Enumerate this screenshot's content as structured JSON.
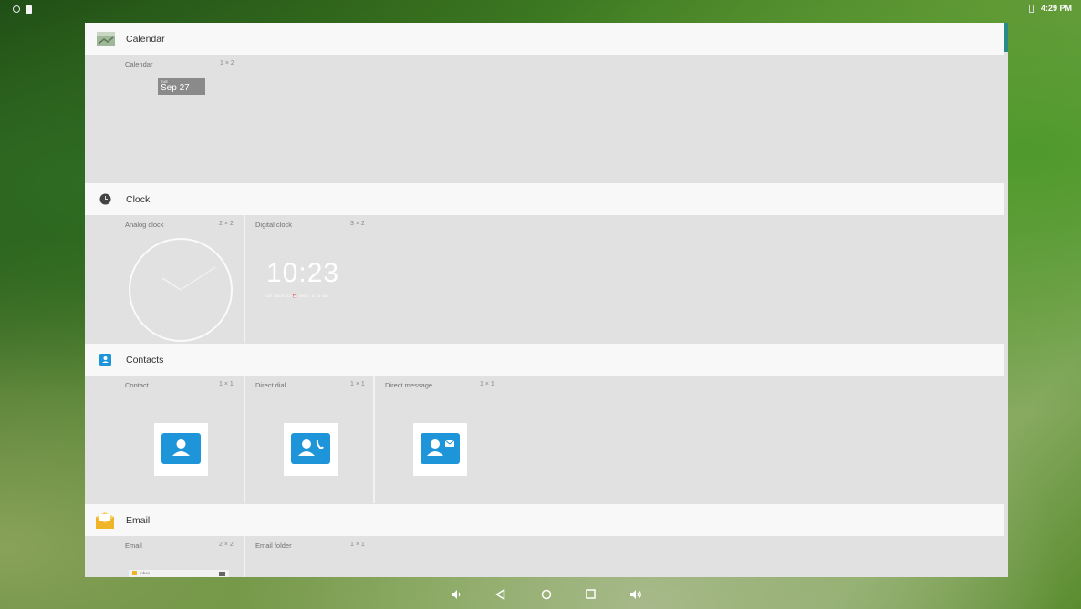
{
  "status_bar": {
    "time": "4:29 PM"
  },
  "sections": {
    "calendar": {
      "title": "Calendar",
      "widgets": [
        {
          "name": "Calendar",
          "size": "1 × 2",
          "preview_day": "TUE",
          "preview_date": "Sep 27"
        }
      ]
    },
    "clock": {
      "title": "Clock",
      "widgets": [
        {
          "name": "Analog clock",
          "size": "2 × 2"
        },
        {
          "name": "Digital clock",
          "size": "3 × 2",
          "preview_time": "10:23",
          "preview_sub": "TUE, MAR 22 ⏰ WED, 6:30 AM"
        }
      ]
    },
    "contacts": {
      "title": "Contacts",
      "widgets": [
        {
          "name": "Contact",
          "size": "1 × 1"
        },
        {
          "name": "Direct dial",
          "size": "1 × 1"
        },
        {
          "name": "Direct message",
          "size": "1 × 1"
        }
      ]
    },
    "email": {
      "title": "Email",
      "widgets": [
        {
          "name": "Email",
          "size": "2 × 2",
          "preview_label": "Inbox"
        },
        {
          "name": "Email folder",
          "size": "1 × 1"
        }
      ]
    }
  },
  "colors": {
    "accent": "#2a8a86",
    "contact_blue": "#1e95d8",
    "panel_bg": "#e1e1e1",
    "header_bg": "#f8f8f8"
  },
  "nav_icons": [
    "volume-down-icon",
    "back-icon",
    "home-icon",
    "recents-icon",
    "volume-up-icon"
  ]
}
